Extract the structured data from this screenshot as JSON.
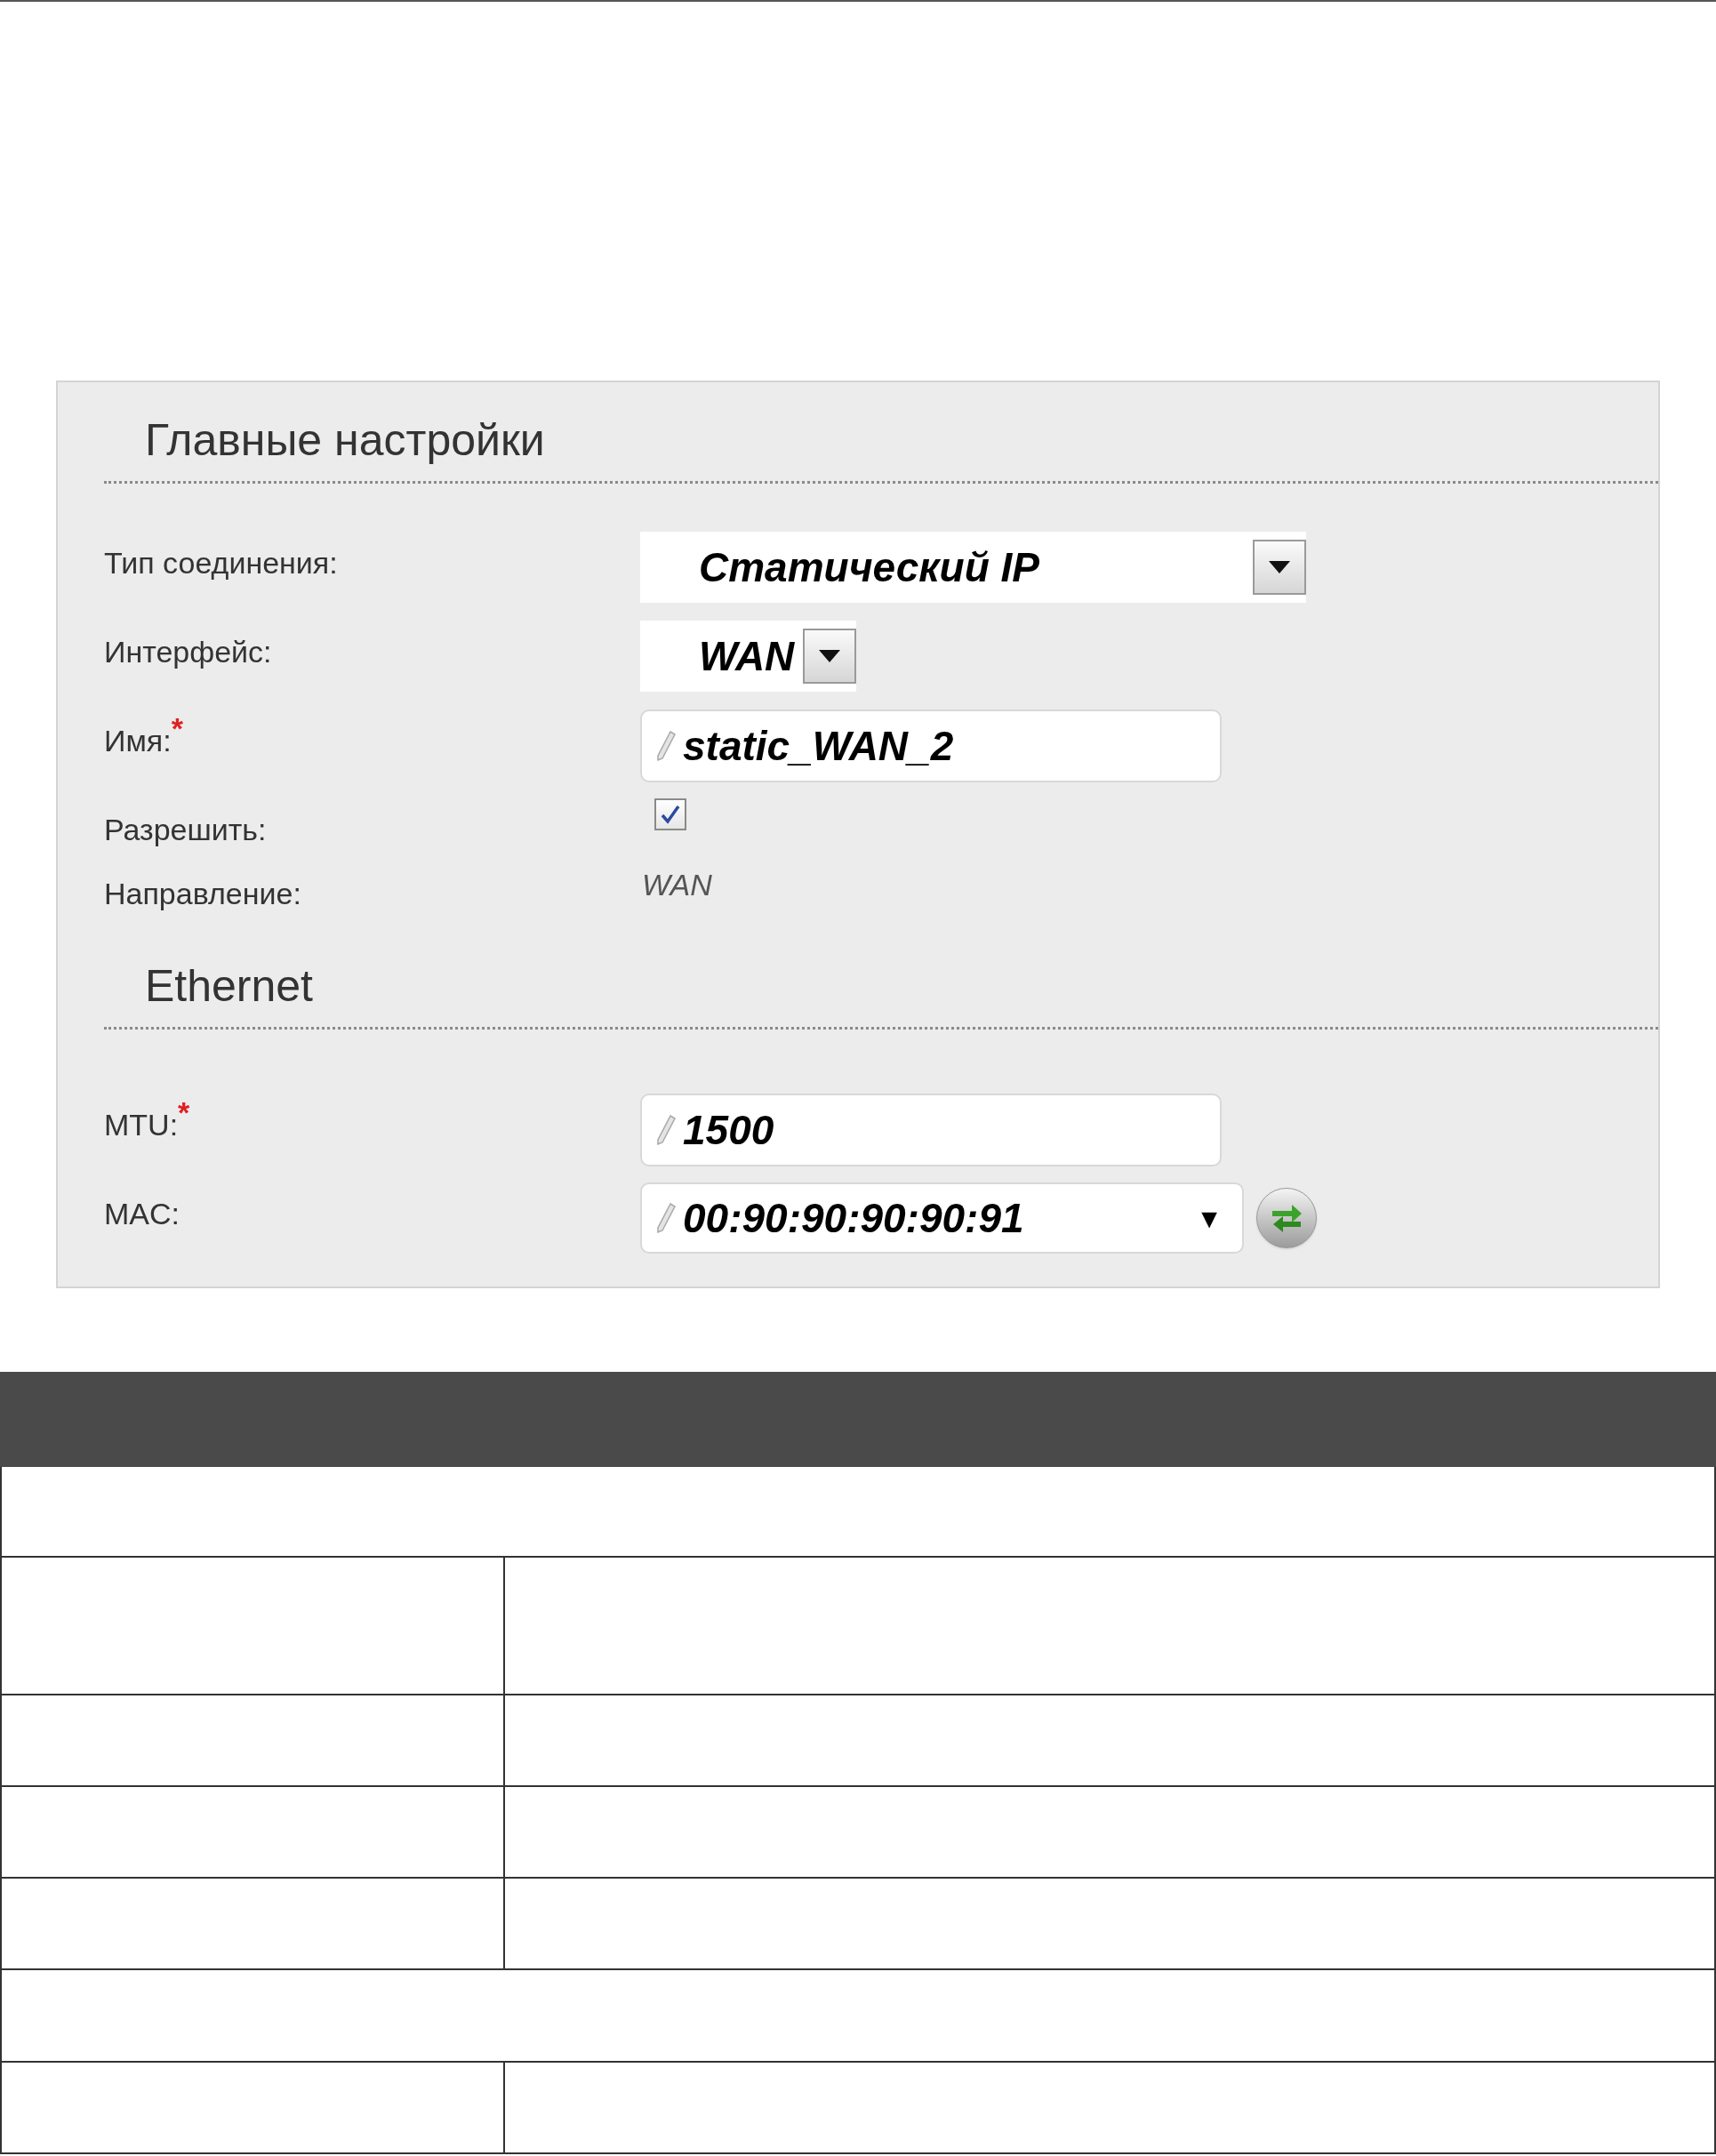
{
  "sections": [
    {
      "title": "Главные настройки",
      "fields": [
        {
          "kind": "select",
          "label": "Тип соединения:",
          "value": "Статический IP"
        },
        {
          "kind": "select",
          "label": "Интерфейс:",
          "value": "WAN"
        },
        {
          "kind": "input",
          "label": "Имя:",
          "mark": "*",
          "value": "static_WAN_2"
        },
        {
          "kind": "checkbox",
          "label": "Разрешить:",
          "checked": true
        },
        {
          "kind": "text",
          "label": "Направление:",
          "value": "WAN"
        }
      ]
    },
    {
      "title": "Ethernet",
      "fields": [
        {
          "kind": "input",
          "label": "MTU:",
          "mark": "*",
          "value": "1500"
        },
        {
          "kind": "combo",
          "label": "MAC:",
          "value": "00:90:90:90:90:91",
          "arrow": "▼"
        }
      ]
    }
  ]
}
